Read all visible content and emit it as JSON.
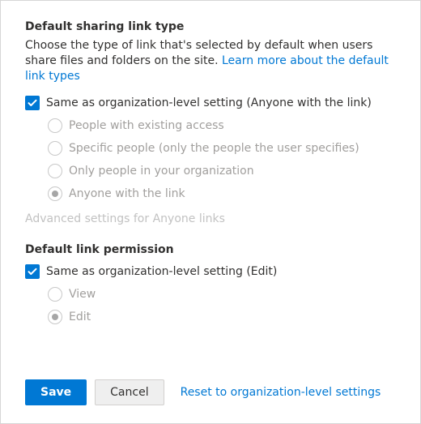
{
  "linkType": {
    "heading": "Default sharing link type",
    "description": "Choose the type of link that's selected by default when users share files and folders on the site.",
    "learnMore": "Learn more about the default link types",
    "sameAsOrg": {
      "checked": true,
      "label": "Same as organization-level setting (Anyone with the link)"
    },
    "options": [
      {
        "label": "People with existing access",
        "selected": false
      },
      {
        "label": "Specific people (only the people the user specifies)",
        "selected": false
      },
      {
        "label": "Only people in your organization",
        "selected": false
      },
      {
        "label": "Anyone with the link",
        "selected": true
      }
    ],
    "advanced": "Advanced settings for Anyone links"
  },
  "linkPermission": {
    "heading": "Default link permission",
    "sameAsOrg": {
      "checked": true,
      "label": "Same as organization-level setting (Edit)"
    },
    "options": [
      {
        "label": "View",
        "selected": false
      },
      {
        "label": "Edit",
        "selected": true
      }
    ]
  },
  "footer": {
    "save": "Save",
    "cancel": "Cancel",
    "reset": "Reset to organization-level settings"
  }
}
